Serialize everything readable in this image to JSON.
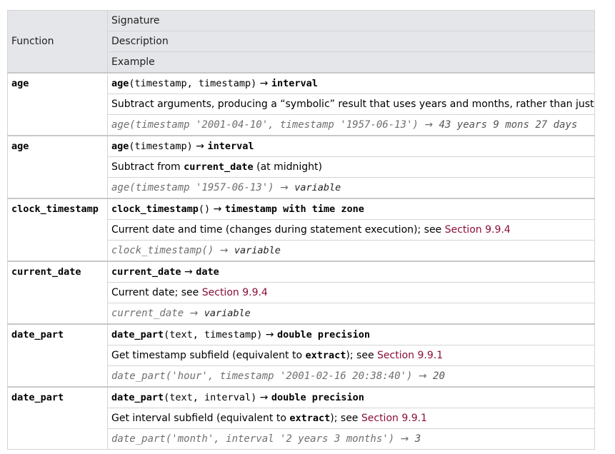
{
  "header": {
    "function": "Function",
    "signature": "Signature",
    "description": "Description",
    "example": "Example"
  },
  "arrow": "→",
  "rows": [
    {
      "name": "age",
      "sig_fn": "age",
      "sig_args": "(timestamp, timestamp)",
      "sig_ret": "interval",
      "desc_text": "Subtract arguments, producing a “symbolic” result that uses years and months, rather than just days",
      "ex_call": "age(timestamp '2001-04-10', timestamp '1957-06-13')",
      "ex_result": "43 years 9 mons 27 days"
    },
    {
      "name": "age",
      "sig_fn": "age",
      "sig_args": "(timestamp)",
      "sig_ret": "interval",
      "desc_pre": "Subtract from ",
      "desc_code": "current_date",
      "desc_post": " (at midnight)",
      "ex_call": "age(timestamp '1957-06-13')",
      "ex_result": "variable"
    },
    {
      "name": "clock_timestamp",
      "sig_fn": "clock_timestamp",
      "sig_args": "()",
      "sig_ret": "timestamp with time zone",
      "desc_text": "Current date and time (changes during statement execution); see ",
      "desc_link": "Section 9.9.4",
      "ex_call": "clock_timestamp()",
      "ex_result": "variable"
    },
    {
      "name": "current_date",
      "sig_fn": "current_date",
      "sig_ret": "date",
      "desc_text": "Current date; see ",
      "desc_link": "Section 9.9.4",
      "ex_call": "current_date",
      "ex_result": "variable"
    },
    {
      "name": "date_part",
      "sig_fn": "date_part",
      "sig_args": "(text, timestamp)",
      "sig_ret": "double precision",
      "desc_pre": "Get timestamp subfield (equivalent to ",
      "desc_code": "extract",
      "desc_post": "); see ",
      "desc_link": "Section 9.9.1",
      "ex_call": "date_part('hour', timestamp '2001-02-16 20:38:40')",
      "ex_result": "20"
    },
    {
      "name": "date_part",
      "sig_fn": "date_part",
      "sig_args": "(text, interval)",
      "sig_ret": "double precision",
      "desc_pre": "Get interval subfield (equivalent to ",
      "desc_code": "extract",
      "desc_post": "); see ",
      "desc_link": "Section 9.9.1",
      "ex_call": "date_part('month', interval '2 years 3 months')",
      "ex_result": "3"
    }
  ],
  "colors": {
    "header_bg": "#e4e6e9",
    "border": "#d4d4d4",
    "link": "#8b0d3a",
    "example_text": "#6f6f6f"
  }
}
